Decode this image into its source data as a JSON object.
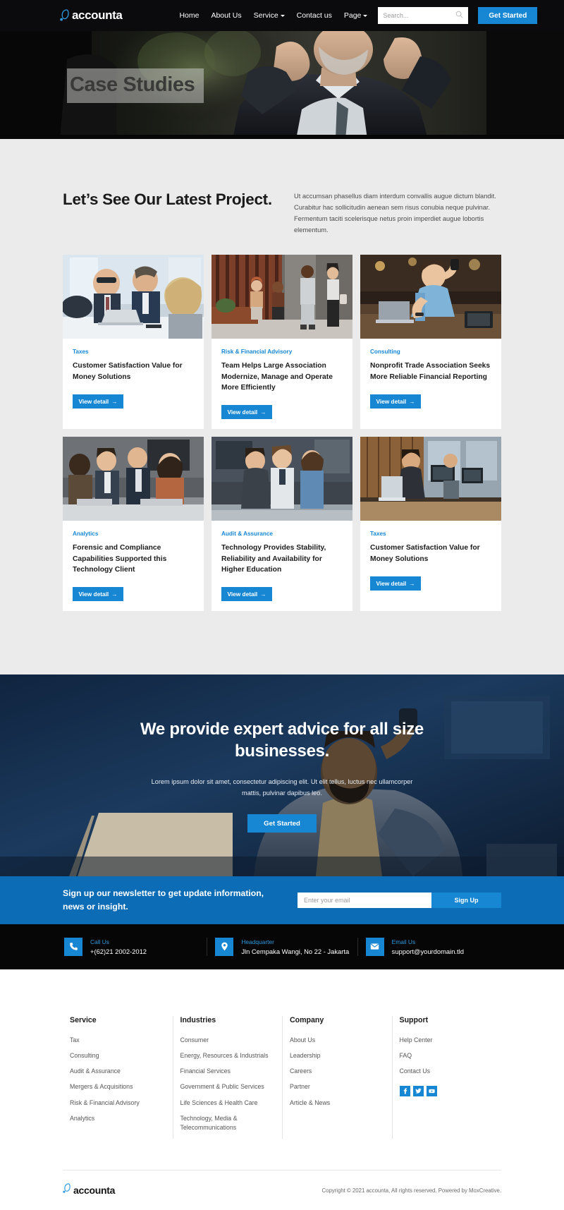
{
  "site": {
    "brand": "accounta",
    "logo_icon": "accounta-logo-icon"
  },
  "nav": {
    "items": [
      {
        "label": "Home",
        "has_caret": false
      },
      {
        "label": "About Us",
        "has_caret": false
      },
      {
        "label": "Service",
        "has_caret": true
      },
      {
        "label": "Contact us",
        "has_caret": false
      },
      {
        "label": "Page",
        "has_caret": true
      }
    ],
    "search_placeholder": "Search...",
    "search_value": "",
    "search_icon": "search-icon",
    "cta_label": "Get Started"
  },
  "hero": {
    "title": "Case Studies"
  },
  "projects": {
    "heading": "Let’s See Our Latest Project.",
    "paragraph": "Ut accumsan phasellus diam interdum convallis augue dictum blandit. Curabitur hac sollicitudin aenean sem risus conubia neque pulvinar. Fermentum taciti scelerisque netus proin imperdiet augue lobortis elementum.",
    "button_label": "View detail",
    "button_icon": "arrow-right-icon",
    "cards": [
      {
        "category": "Taxes",
        "title": "Customer Satisfaction Value for Money Solutions",
        "image_alt": "business-team-meeting-laptop"
      },
      {
        "category": "Risk & Financial Advisory",
        "title": "Team Helps Large Association Modernize, Manage and Operate More Efficiently",
        "image_alt": "four-professionals-outside-building"
      },
      {
        "category": "Consulting",
        "title": "Nonprofit Trade Association Seeks More Reliable Financial Reporting",
        "image_alt": "man-on-phone-checking-watch"
      },
      {
        "category": "Analytics",
        "title": "Forensic and Compliance Capabilities Supported this Technology Client",
        "image_alt": "group-discussion-around-table"
      },
      {
        "category": "Audit & Assurance",
        "title": "Technology Provides Stability, Reliability and Availability for Higher Education",
        "image_alt": "team-standing-in-office"
      },
      {
        "category": "Taxes",
        "title": "Customer Satisfaction Value for Money Solutions",
        "image_alt": "man-working-at-desk-with-computers"
      }
    ]
  },
  "cta": {
    "heading": "We provide expert advice for all size businesses.",
    "paragraph": "Lorem ipsum dolor sit amet, consectetur adipiscing elit. Ut elit tellus, luctus nec ullamcorper mattis, pulvinar dapibus leo.",
    "button_label": "Get Started"
  },
  "newsletter": {
    "heading": "Sign up our newsletter to get update information, news or insight.",
    "placeholder": "Enter your email",
    "value": "",
    "button_label": "Sign Up"
  },
  "contact": [
    {
      "icon": "phone-icon",
      "label": "Call Us",
      "value": "+(62)21 2002-2012"
    },
    {
      "icon": "map-pin-icon",
      "label": "Headquarter",
      "value": "Jln Cempaka Wangi, No 22 - Jakarta"
    },
    {
      "icon": "envelope-icon",
      "label": "Email Us",
      "value": "support@yourdomain.tld"
    }
  ],
  "footer": {
    "columns": [
      {
        "title": "Service",
        "links": [
          "Tax",
          "Consulting",
          "Audit & Assurance",
          "Mergers & Acquisitions",
          "Risk & Financial Advisory",
          "Analytics"
        ]
      },
      {
        "title": "Industries",
        "links": [
          "Consumer",
          "Energy, Resources & Industrials",
          "Financial Services",
          "Government & Public Services",
          "Life Sciences & Health Care",
          "Technology, Media & Telecommunications"
        ]
      },
      {
        "title": "Company",
        "links": [
          "About Us",
          "Leadership",
          "Careers",
          "Partner",
          "Article & News"
        ]
      },
      {
        "title": "Support",
        "links": [
          "Help Center",
          "FAQ",
          "Contact Us"
        ]
      }
    ],
    "socials": [
      {
        "icon": "facebook-icon",
        "glyph": "f"
      },
      {
        "icon": "twitter-icon",
        "glyph": "t"
      },
      {
        "icon": "youtube-icon",
        "glyph": "y"
      }
    ],
    "brand": "accounta",
    "copyright": "Copyright © 2021 accounta, All rights reserved. Powered by MoxCreative."
  },
  "colors": {
    "accent": "#1787d4",
    "accent_dark": "#0c6cb5",
    "dark": "#0b0b0d",
    "page_bg": "#ebebeb"
  }
}
